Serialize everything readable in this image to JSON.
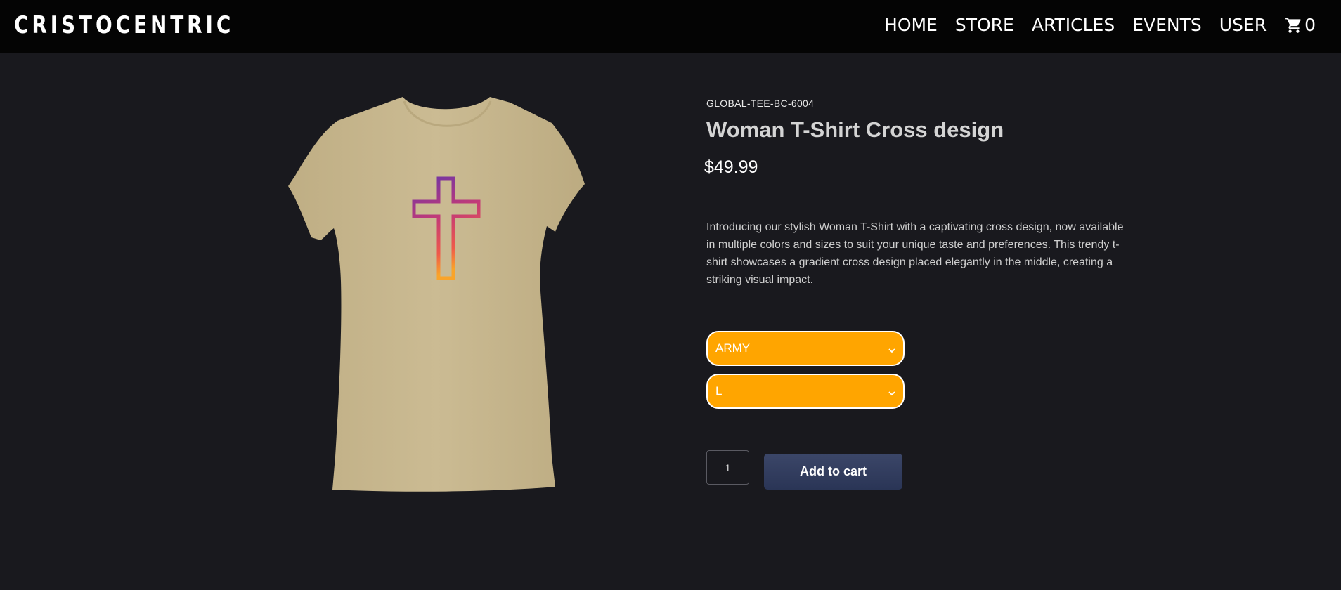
{
  "header": {
    "logo": "CRISTOCENTRIC",
    "nav": [
      "HOME",
      "STORE",
      "ARTICLES",
      "EVENTS",
      "USER"
    ],
    "cart_count": "0",
    "cart_icon": "cart-icon"
  },
  "product": {
    "sku": "GLOBAL-TEE-BC-6004",
    "title": "Woman T-Shirt Cross design",
    "price": "$49.99",
    "description": "Introducing our stylish Woman T-Shirt with a captivating cross design, now available in multiple colors and sizes to suit your unique taste and preferences. This trendy t-shirt showcases a gradient cross design placed elegantly in the middle, creating a striking visual impact.",
    "color_selected": "ARMY",
    "size_selected": "L",
    "quantity": "1",
    "add_to_cart": "Add to cart"
  },
  "colors": {
    "background": "#19191e",
    "navbar": "#040404",
    "select": "#ffa500",
    "button": "#2f3a5c",
    "shirt": "#c9b990"
  }
}
